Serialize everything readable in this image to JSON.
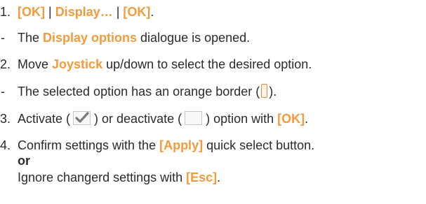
{
  "step1": {
    "num": "1.",
    "ok1": "[OK]",
    "pipe1": " | ",
    "display": "Display…",
    "pipe2": " | ",
    "ok2": "[OK]",
    "end": "."
  },
  "result1": {
    "dash": "-",
    "pre": "The ",
    "highlight": "Display options",
    "post": " dialogue is opened."
  },
  "step2": {
    "num": "2.",
    "pre": "Move ",
    "highlight": "Joystick",
    "post": " up/down to select the desired option."
  },
  "result2": {
    "dash": "-",
    "pre": "The selected option has an orange border (",
    "post": ")."
  },
  "step3": {
    "num": "3.",
    "pre1": "Activate (",
    "mid": ") or deactivate (",
    "post1": ") option with ",
    "highlight": "[OK]",
    "end": "."
  },
  "step4": {
    "num": "4.",
    "pre": "Confirm settings with the ",
    "highlight": "[Apply]",
    "post": " quick select button.",
    "or": "or",
    "alt_pre": "Ignore changerd settings with ",
    "alt_highlight": "[Esc]",
    "alt_end": "."
  },
  "colors": {
    "accent": "#f39a3d",
    "text": "#2b2b2b",
    "check": "#7a7a7a"
  },
  "icons": {
    "border_example": "orange-border-icon",
    "checked": "checkbox-checked-icon",
    "unchecked": "checkbox-empty-icon"
  }
}
